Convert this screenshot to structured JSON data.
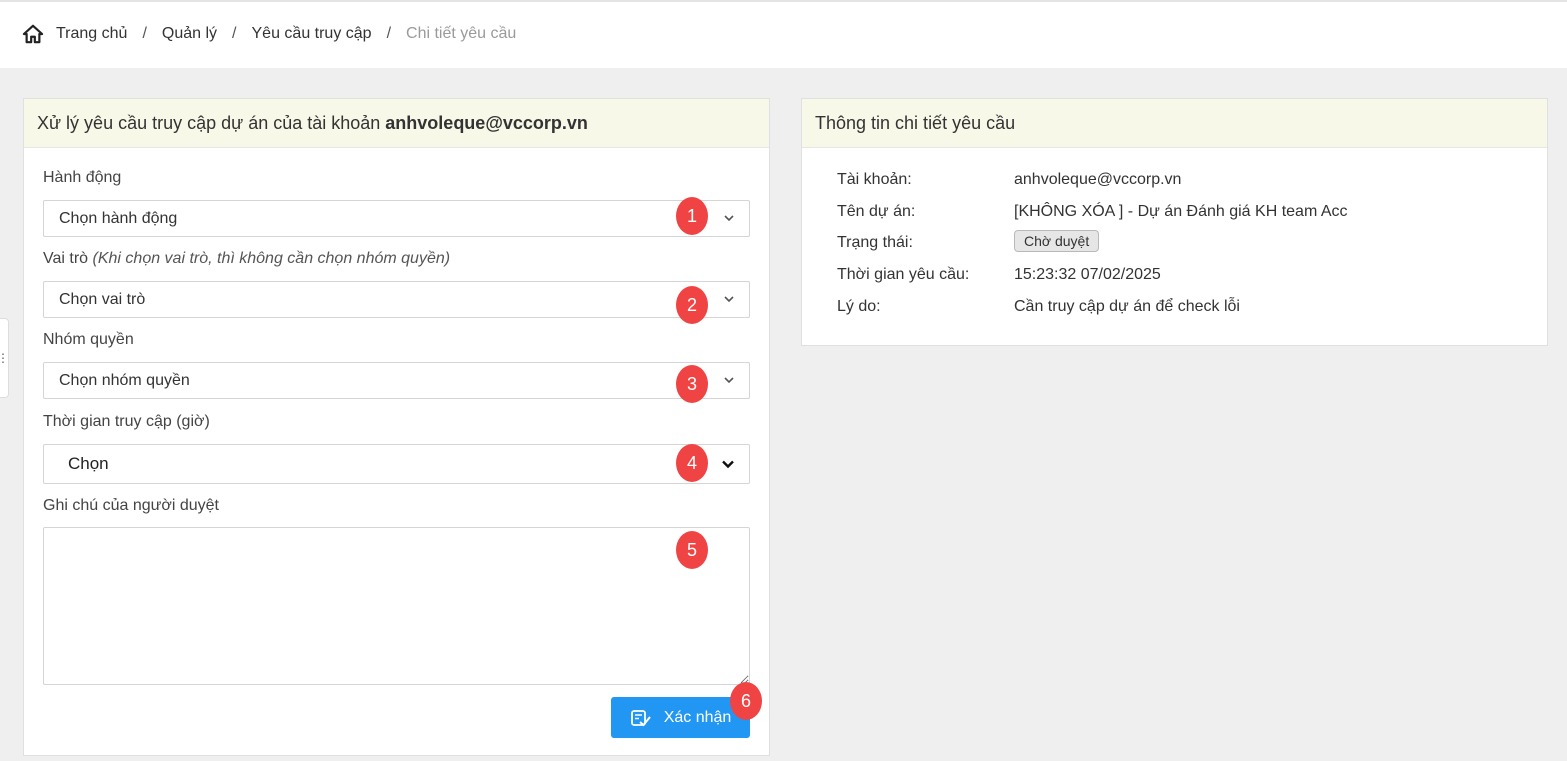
{
  "breadcrumb": {
    "items": [
      "Trang chủ",
      "Quản lý",
      "Yêu cầu truy cập"
    ],
    "separator": "/",
    "current": "Chi tiết yêu cầu"
  },
  "form_panel": {
    "title_prefix": "Xử lý yêu cầu truy cập dự án của tài khoản",
    "title_account": "anhvoleque@vccorp.vn",
    "action": {
      "label": "Hành động",
      "value": "Chọn hành động"
    },
    "role": {
      "label": "Vai trò",
      "hint": "(Khi chọn vai trò, thì không cần chọn nhóm quyền)",
      "value": "Chọn vai trò"
    },
    "permission_group": {
      "label": "Nhóm quyền",
      "value": "Chọn nhóm quyền"
    },
    "access_time": {
      "label": "Thời gian truy cập (giờ)",
      "value": "Chọn"
    },
    "note": {
      "label": "Ghi chú của người duyệt",
      "value": ""
    },
    "confirm_label": "Xác nhận"
  },
  "detail_panel": {
    "title": "Thông tin chi tiết yêu cầu",
    "rows": [
      {
        "key": "Tài khoản:",
        "value": "anhvoleque@vccorp.vn"
      },
      {
        "key": "Tên dự án:",
        "value": "[KHÔNG XÓA ] - Dự án Đánh giá KH team Acc"
      },
      {
        "key": "Trạng thái:",
        "value": "Chờ duyệt"
      },
      {
        "key": "Thời gian yêu cầu:",
        "value": "15:23:32 07/02/2025"
      },
      {
        "key": "Lý do:",
        "value": "Cần truy cập dự án để check lỗi"
      }
    ]
  },
  "annotations": [
    "1",
    "2",
    "3",
    "4",
    "5",
    "6"
  ],
  "colors": {
    "accent": "#2196f3",
    "annotation": "#f04444",
    "panel_header": "#f8f8e8"
  }
}
